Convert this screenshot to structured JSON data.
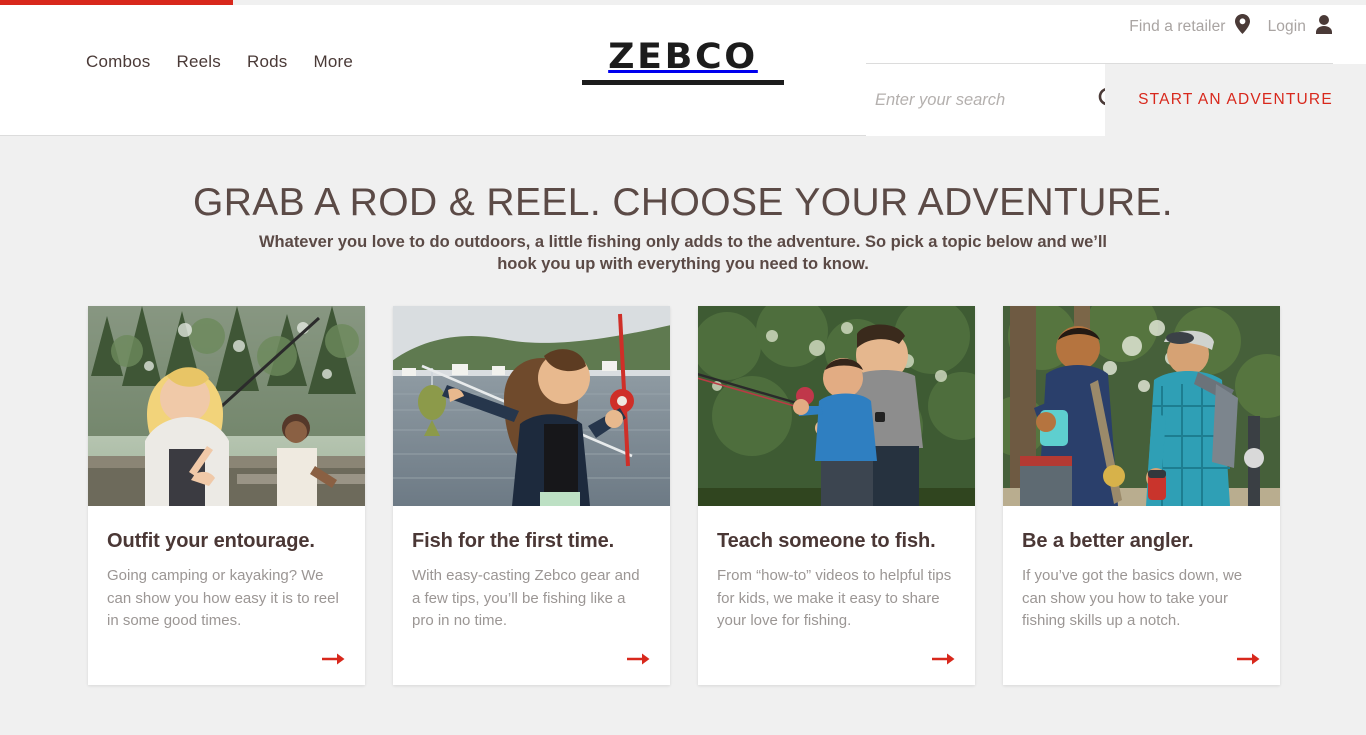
{
  "topbar": {
    "progress_percent": 17,
    "fill_color": "#d8281c",
    "track_color": "#f0f0f0"
  },
  "header": {
    "brand": {
      "wordmark": "ZEBCO",
      "color": "#1c1c1c"
    },
    "nav": [
      {
        "label": "Combos",
        "name": "nav-link-combos"
      },
      {
        "label": "Reels",
        "name": "nav-link-reels"
      },
      {
        "label": "Rods",
        "name": "nav-link-rods"
      },
      {
        "label": "More",
        "name": "nav-link-more"
      }
    ],
    "utility": {
      "find_retailer_label": "Find a retailer",
      "find_retailer_icon": "map-pin-icon",
      "login_label": "Login",
      "login_icon": "user-icon",
      "link_color": "#a9a4a2"
    },
    "search": {
      "value": "",
      "placeholder": "Enter your search",
      "icon": "search-icon"
    },
    "cta": {
      "label": "START AN ADVENTURE",
      "color": "#d8281c",
      "background": "#f0f0f0"
    }
  },
  "main": {
    "title": "GRAB A ROD & REEL. CHOOSE YOUR ADVENTURE.",
    "subtitle": "Whatever you love to do outdoors, a little fishing only adds to the adventure. So pick a topic below and we’ll hook you up with everything you need to know.",
    "title_color": "#5b4a46",
    "background": "#f0f0f0",
    "cards": [
      {
        "title": "Outfit your entourage.",
        "text": "Going camping or kayaking? We can show you how easy it is to reel in some good times.",
        "image_alt": "Smiling woman casting a fishing rod by a forest lake with a man fishing behind her",
        "arrow_icon": "arrow-right-icon",
        "arrow_color": "#d8281c"
      },
      {
        "title": "Fish for the first time.",
        "text": "With easy-casting Zebco gear and a few tips, you’ll be fishing like a pro in no time.",
        "image_alt": "Woman on a lake holding up a caught fish in one hand and a red spincast rod in the other",
        "arrow_icon": "arrow-right-icon",
        "arrow_color": "#d8281c"
      },
      {
        "title": "Teach someone to fish.",
        "text": "From “how-to” videos to helpful tips for kids, we make it easy to share your love for fishing.",
        "image_alt": "Man teaching a boy in a blue shirt to cast a fishing rod in front of green trees",
        "arrow_icon": "arrow-right-icon",
        "arrow_color": "#d8281c"
      },
      {
        "title": "Be a better angler.",
        "text": "If you’ve got the basics down, we can show you how to take your fishing skills up a notch.",
        "image_alt": "Two men walking with fishing gear and drinks, laughing, on a wooded trail",
        "arrow_icon": "arrow-right-icon",
        "arrow_color": "#d8281c"
      }
    ]
  }
}
